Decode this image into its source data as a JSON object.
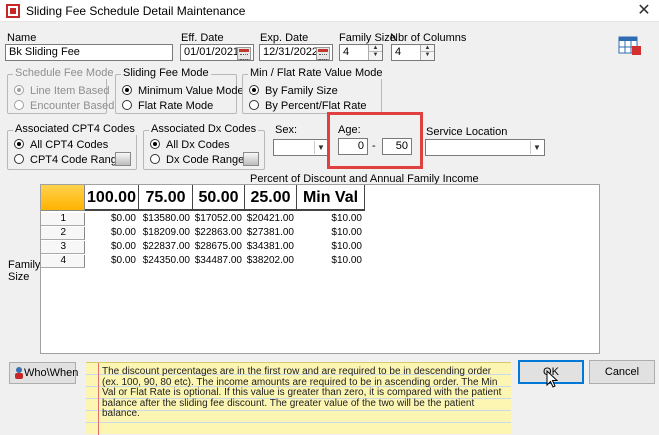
{
  "window": {
    "title": "Sliding Fee Schedule Detail Maintenance",
    "close_glyph": "✕"
  },
  "fields": {
    "name_label": "Name",
    "name_value": "Bk Sliding Fee",
    "eff_date_label": "Eff. Date",
    "eff_date_value": "01/01/2021",
    "exp_date_label": "Exp. Date",
    "exp_date_value": "12/31/2022",
    "family_size_label": "Family Size",
    "family_size_value": "4",
    "nbr_columns_label": "Nbr of Columns",
    "nbr_columns_value": "4"
  },
  "schedule_fee_mode": {
    "title": "Schedule Fee Mode",
    "options": [
      "Line Item Based",
      "Encounter Based"
    ],
    "selected": 0,
    "disabled": true
  },
  "sliding_fee_mode": {
    "title": "Sliding Fee Mode",
    "options": [
      "Minimum Value Mode",
      "Flat Rate Mode"
    ],
    "selected": 0
  },
  "min_flat_rate_mode": {
    "title": "Min / Flat Rate Value Mode",
    "options": [
      "By Family Size",
      "By Percent/Flat Rate"
    ],
    "selected": 0
  },
  "cpt4_codes": {
    "title": "Associated CPT4 Codes",
    "options": [
      "All CPT4 Codes",
      "CPT4 Code Range"
    ],
    "selected": 0
  },
  "dx_codes": {
    "title": "Associated Dx Codes",
    "options": [
      "All Dx Codes",
      "Dx Code Range"
    ],
    "selected": 0
  },
  "sex": {
    "label": "Sex:",
    "value": ""
  },
  "age": {
    "label": "Age:",
    "from": "0",
    "separator": "-",
    "to": "50"
  },
  "service_location": {
    "label": "Service Location",
    "value": ""
  },
  "grid": {
    "caption": "Percent of Discount and Annual Family Income",
    "side_label": "Family Size",
    "columns": [
      "100.00",
      "75.00",
      "50.00",
      "25.00",
      "Min Val"
    ],
    "rows": [
      {
        "size": "1",
        "cells": [
          "$0.00",
          "$13580.00",
          "$17052.00",
          "$20421.00",
          "$10.00"
        ]
      },
      {
        "size": "2",
        "cells": [
          "$0.00",
          "$18209.00",
          "$22863.00",
          "$27381.00",
          "$10.00"
        ]
      },
      {
        "size": "3",
        "cells": [
          "$0.00",
          "$22837.00",
          "$28675.00",
          "$34381.00",
          "$10.00"
        ]
      },
      {
        "size": "4",
        "cells": [
          "$0.00",
          "$24350.00",
          "$34487.00",
          "$38202.00",
          "$10.00"
        ]
      }
    ]
  },
  "buttons": {
    "who_when": "Who\\When",
    "ok": "OK",
    "cancel": "Cancel"
  },
  "note": "The discount percentages are in the first row and are required to be in descending order (ex. 100, 90, 80 etc).  The income amounts are required to be in ascending order.  The Min Val or Flat Rate is optional.  If this value is greater than zero, it is compared with the patient balance after the sliding fee discount.  The greater value of the two will be the patient balance.",
  "colors": {
    "highlight": "#e04040",
    "corner": "#ffc21a",
    "note_bg": "#fdf6b3"
  }
}
